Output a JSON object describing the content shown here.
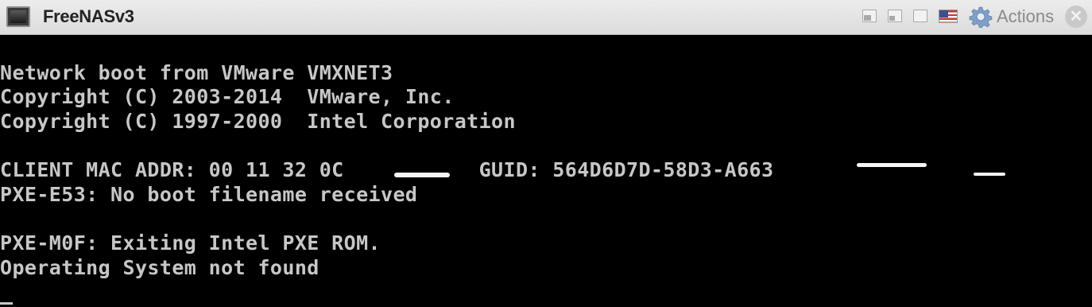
{
  "window": {
    "title": "FreeNASv3",
    "actions_label": "Actions",
    "close_glyph": "✕",
    "icons": [
      "console-icon",
      "minimize-icon",
      "restore-icon",
      "maximize-icon",
      "us-flag-icon",
      "gear-icon",
      "close-icon"
    ]
  },
  "console": {
    "lines": [
      "Network boot from VMware VMXNET3",
      "Copyright (C) 2003-2014  VMware, Inc.",
      "Copyright (C) 1997-2000  Intel Corporation",
      "",
      "CLIENT MAC ADDR: 00 11 32 0C           GUID: 564D6D7D-58D3-A663",
      "PXE-E53: No boot filename received",
      "",
      "PXE-M0F: Exiting Intel PXE ROM.",
      "Operating System not found"
    ],
    "text_color": "#c7c7c7",
    "background_color": "#000000"
  }
}
